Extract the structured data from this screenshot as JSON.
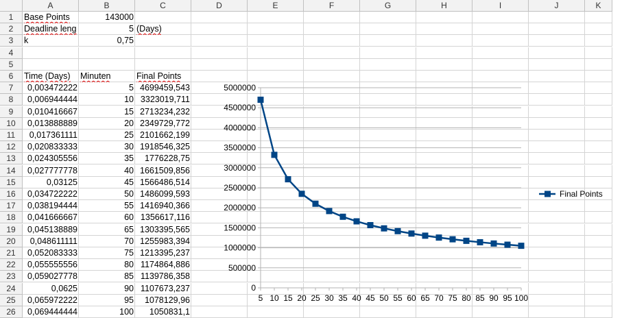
{
  "columns": [
    "A",
    "B",
    "C",
    "D",
    "E",
    "F",
    "G",
    "H",
    "I",
    "J",
    "K"
  ],
  "rows": [
    "1",
    "2",
    "3",
    "4",
    "5",
    "6",
    "7",
    "8",
    "9",
    "10",
    "11",
    "12",
    "13",
    "14",
    "15",
    "16",
    "17",
    "18",
    "19",
    "20",
    "21",
    "22",
    "23",
    "24",
    "25",
    "26"
  ],
  "params": [
    {
      "label": "Base Points",
      "value": "143000",
      "unit": ""
    },
    {
      "label": "Deadline leng",
      "value": "5",
      "unit": "(Days)"
    },
    {
      "label": "k",
      "value": "0,75",
      "unit": ""
    }
  ],
  "table_headers": [
    "Time (Days)",
    "Minuten",
    "Final Points"
  ],
  "table_rows": [
    [
      "0,003472222",
      "5",
      "4699459,543"
    ],
    [
      "0,006944444",
      "10",
      "3323019,711"
    ],
    [
      "0,010416667",
      "15",
      "2713234,232"
    ],
    [
      "0,013888889",
      "20",
      "2349729,772"
    ],
    [
      "0,017361111",
      "25",
      "2101662,199"
    ],
    [
      "0,020833333",
      "30",
      "1918546,325"
    ],
    [
      "0,024305556",
      "35",
      "1776228,75"
    ],
    [
      "0,027777778",
      "40",
      "1661509,856"
    ],
    [
      "0,03125",
      "45",
      "1566486,514"
    ],
    [
      "0,034722222",
      "50",
      "1486099,593"
    ],
    [
      "0,038194444",
      "55",
      "1416940,366"
    ],
    [
      "0,041666667",
      "60",
      "1356617,116"
    ],
    [
      "0,045138889",
      "65",
      "1303395,565"
    ],
    [
      "0,048611111",
      "70",
      "1255983,394"
    ],
    [
      "0,052083333",
      "75",
      "1213395,237"
    ],
    [
      "0,055555556",
      "80",
      "1174864,886"
    ],
    [
      "0,059027778",
      "85",
      "1139786,358"
    ],
    [
      "0,0625",
      "90",
      "1107673,237"
    ],
    [
      "0,065972222",
      "95",
      "1078129,96"
    ],
    [
      "0,069444444",
      "100",
      "1050831,1"
    ]
  ],
  "chart_data": {
    "type": "line",
    "x": [
      5,
      10,
      15,
      20,
      25,
      30,
      35,
      40,
      45,
      50,
      55,
      60,
      65,
      70,
      75,
      80,
      85,
      90,
      95,
      100
    ],
    "series": [
      {
        "name": "Final Points",
        "values": [
          4699459.543,
          3323019.711,
          2713234.232,
          2349729.772,
          2101662.199,
          1918546.325,
          1776228.75,
          1661509.856,
          1566486.514,
          1486099.593,
          1416940.366,
          1356617.116,
          1303395.565,
          1255983.394,
          1213395.237,
          1174864.886,
          1139786.358,
          1107673.237,
          1078129.96,
          1050831.1
        ]
      }
    ],
    "ylim": [
      0,
      5000000
    ],
    "yticks": [
      "0",
      "500000",
      "1000000",
      "1500000",
      "2000000",
      "2500000",
      "3000000",
      "3500000",
      "4000000",
      "4500000",
      "5000000"
    ],
    "xticks": [
      "5",
      "10",
      "15",
      "20",
      "25",
      "30",
      "35",
      "40",
      "45",
      "50",
      "55",
      "60",
      "65",
      "70",
      "75",
      "80",
      "85",
      "90",
      "95",
      "100"
    ],
    "grid": "horizontal",
    "legend_position": "right",
    "color": "#004586"
  }
}
